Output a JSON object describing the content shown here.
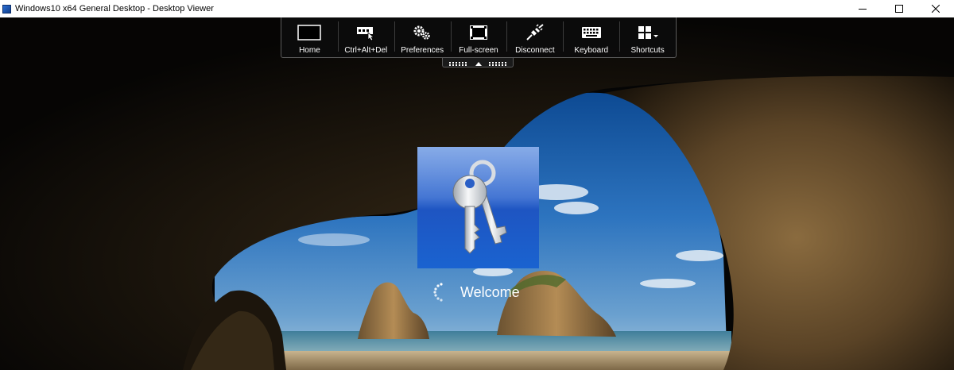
{
  "window": {
    "title": "Windows10 x64 General Desktop - Desktop Viewer",
    "controls": [
      "minimize-icon",
      "maximize-icon",
      "close-icon"
    ]
  },
  "toolbar": {
    "items": [
      {
        "label": "Home",
        "icon": "home-icon"
      },
      {
        "label": "Ctrl+Alt+Del",
        "icon": "ctrl-alt-del-icon"
      },
      {
        "label": "Preferences",
        "icon": "gears-icon"
      },
      {
        "label": "Full-screen",
        "icon": "fullscreen-icon"
      },
      {
        "label": "Disconnect",
        "icon": "plug-icon"
      },
      {
        "label": "Keyboard",
        "icon": "keyboard-icon"
      },
      {
        "label": "Shortcuts",
        "icon": "grid-icon"
      }
    ]
  },
  "login": {
    "tile_icon": "keys-icon",
    "status": "Welcome"
  },
  "colors": {
    "toolbar_bg": "#0c0c0c",
    "tile_blue": "#1e55c2",
    "sky": "#2d6fb6"
  }
}
